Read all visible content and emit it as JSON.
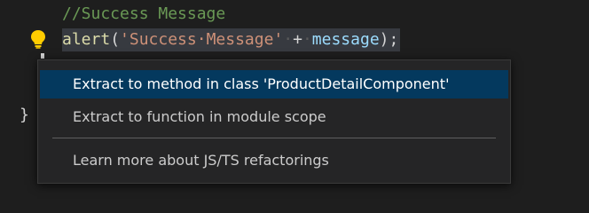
{
  "editor": {
    "comment_line": "//Success Message",
    "code_line": {
      "fn": "alert",
      "open_paren": "(",
      "string_literal": "'Success·Message'",
      "space1": "·",
      "plus": "+",
      "space2": "·",
      "variable": "message",
      "close": ");"
    },
    "closing_brace": "}"
  },
  "quick_fix": {
    "icon": "lightbulb-icon",
    "items": [
      {
        "label": "Extract to method in class 'ProductDetailComponent'",
        "selected": true
      },
      {
        "label": "Extract to function in module scope",
        "selected": false
      },
      {
        "label": "Learn more about JS/TS refactorings",
        "selected": false
      }
    ]
  },
  "colors": {
    "background": "#1e1e1e",
    "comment": "#6a9955",
    "function": "#dcdcaa",
    "string": "#ce9178",
    "variable": "#9cdcfe",
    "selection_line": "#373a40",
    "menu_background": "#252526",
    "menu_selected": "#04395e",
    "lightbulb": "#ffcc00"
  }
}
